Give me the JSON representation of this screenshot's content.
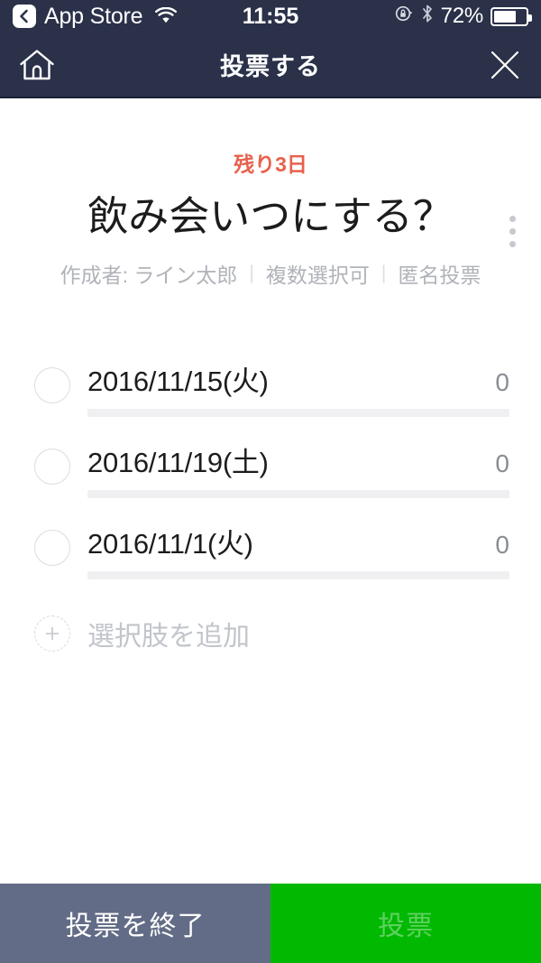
{
  "statusbar": {
    "back_label": "App Store",
    "back_icon": "chevron-left-icon",
    "wifi_icon": "wifi-icon",
    "time": "11:55",
    "rotation_lock_icon": "rotation-lock-icon",
    "bluetooth_icon": "bluetooth-icon",
    "battery_percent": "72%",
    "battery_level": 72
  },
  "navbar": {
    "home_icon": "home-icon",
    "title": "投票する",
    "close_icon": "close-icon"
  },
  "content": {
    "kebab_icon": "more-vertical-icon",
    "deadline": "残り3日",
    "title": "飲み会いつにする？",
    "meta": {
      "author": "作成者: ライン太郎",
      "separator": "|",
      "multi_select": "複数選択可",
      "anonymous": "匿名投票"
    },
    "options": [
      {
        "label": "2016/11/15(火)",
        "count": "0",
        "percent": 0
      },
      {
        "label": "2016/11/19(土)",
        "count": "0",
        "percent": 0
      },
      {
        "label": "2016/11/1(火)",
        "count": "0",
        "percent": 0
      }
    ],
    "add_option": {
      "icon": "plus-circle-dashed-icon",
      "label": "選択肢を追加"
    }
  },
  "bottombar": {
    "end_poll_label": "投票を終了",
    "vote_label": "投票"
  },
  "colors": {
    "navbar_bg": "#2a3149",
    "accent_red": "#e8614d",
    "line_green": "#00b900",
    "end_button_bg": "#636c86",
    "bar_track": "#f0f0f2",
    "muted_text": "#b0b3b9"
  }
}
